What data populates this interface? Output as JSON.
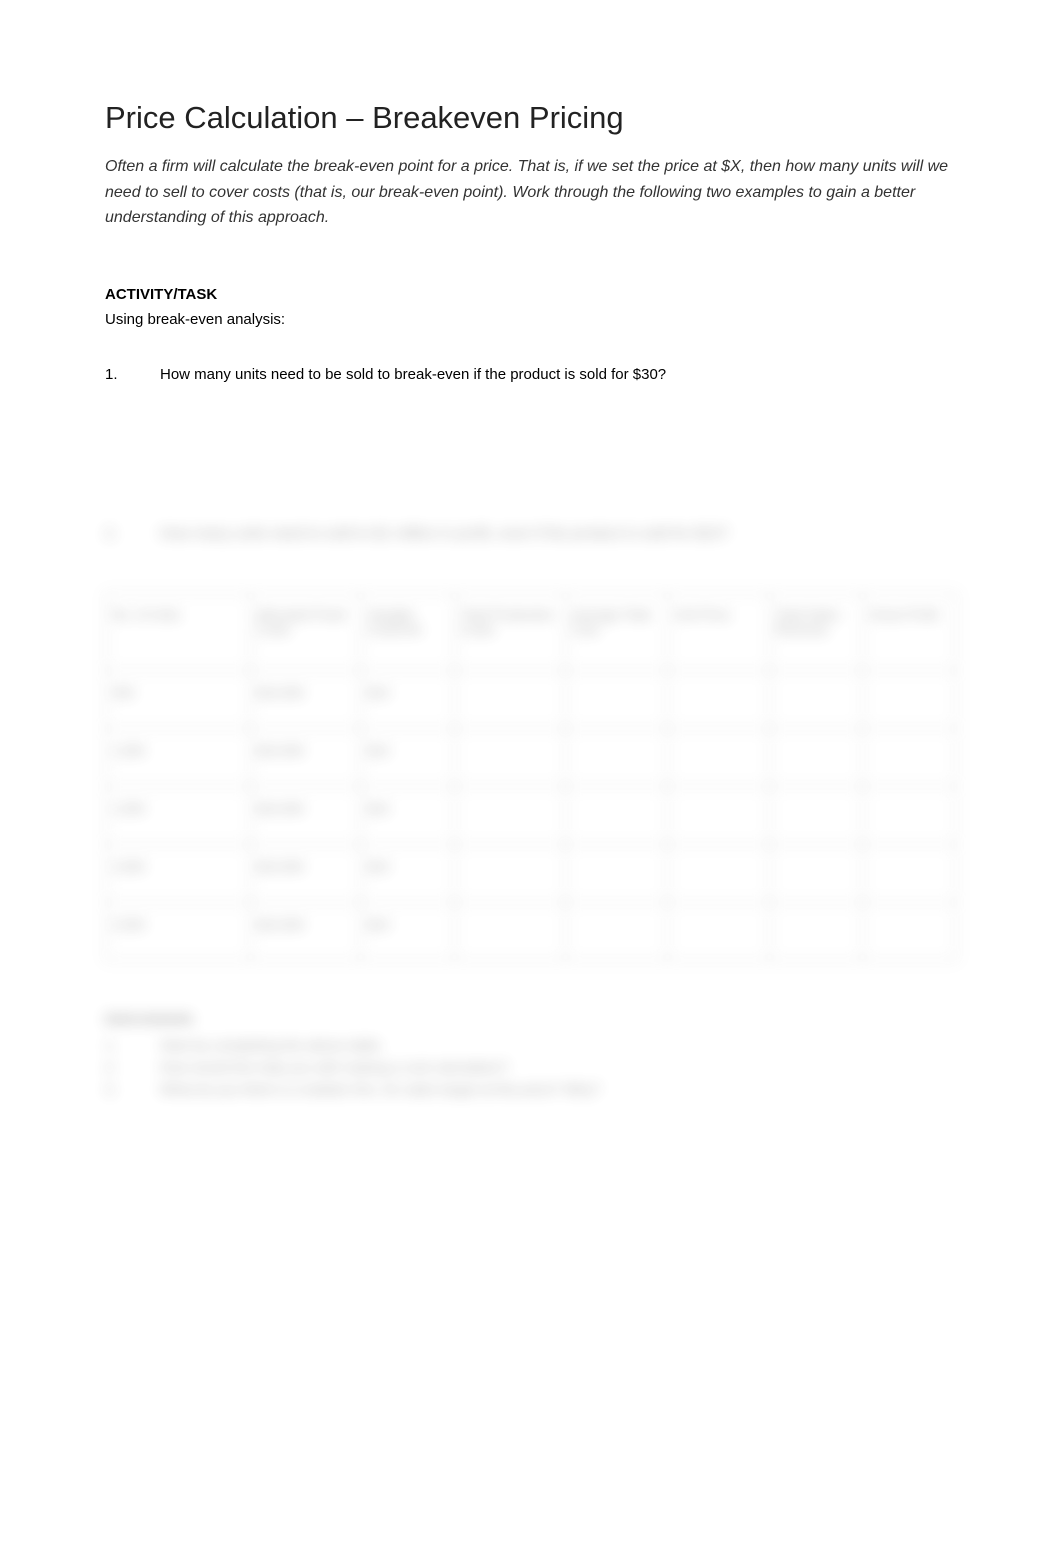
{
  "title": "Price Calculation – Breakeven Pricing",
  "intro": "Often a firm will calculate the break-even point for a price. That is, if we set the price at $X, then how many units will we need to sell to cover costs (that is, our break-even point). Work through the following two examples to gain a better understanding of this approach.",
  "activity": {
    "heading": "ACTIVITY/TASK",
    "instruction": "Using break-even analysis:"
  },
  "questions": [
    {
      "num": "1.",
      "text": "How many units need to be sold to break-even if the product is sold for $30?"
    },
    {
      "num": "2.",
      "text": "How many units need to sold to $1 million in profit, even if the product is sold for $10?"
    }
  ],
  "table": {
    "headers": [
      "No. of Units",
      "Allocated Fixed Costs",
      "Variable Cost/Unit",
      "Total Production Costs",
      "Average Total Cost",
      "Unit Price",
      "Total Sales Revenue",
      "Gross Profit"
    ],
    "rows": [
      {
        "cells": [
          "500",
          "$10,000",
          "$10",
          "",
          "",
          "",
          "",
          ""
        ]
      },
      {
        "cells": [
          "1,000",
          "$10,000",
          "$10",
          "",
          "",
          "",
          "",
          ""
        ]
      },
      {
        "cells": [
          "1,500",
          "$10,000",
          "$10",
          "",
          "",
          "",
          "",
          ""
        ]
      },
      {
        "cells": [
          "2,000",
          "$10,000",
          "$10",
          "",
          "",
          "",
          "",
          ""
        ]
      },
      {
        "cells": [
          "2,500",
          "$10,000",
          "$10",
          "",
          "",
          "",
          "",
          ""
        ]
      }
    ]
  },
  "discussion": {
    "heading": "DISCUSSION",
    "items": [
      {
        "num": "1.",
        "text": "Start by completing the above table."
      },
      {
        "num": "2.",
        "text": "How would this help you with making a cost calculation?"
      },
      {
        "num": "3.",
        "text": "What do you think is a realistic firm, for sales target at this price? Why?"
      }
    ]
  }
}
